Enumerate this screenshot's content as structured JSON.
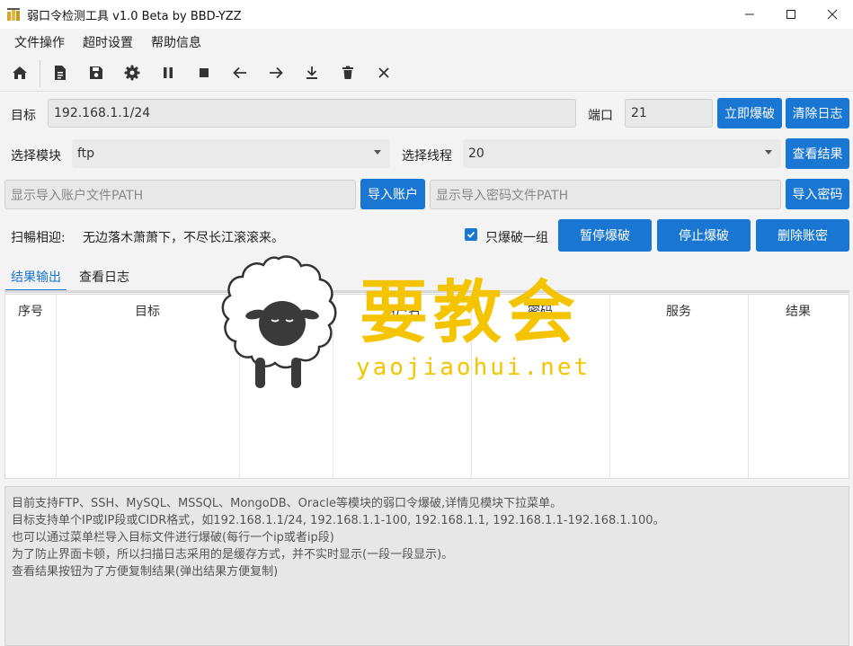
{
  "window": {
    "title": "弱口令检测工具 v1.0 Beta by BBD-YZZ",
    "minimize_icon": "minimize-icon",
    "maximize_icon": "maximize-icon",
    "close_icon": "close-icon"
  },
  "menu": [
    "文件操作",
    "超时设置",
    "帮助信息"
  ],
  "toolbar": [
    "home-icon",
    "document-icon",
    "save-icon",
    "gear-icon",
    "pause-icon",
    "stop-icon",
    "arrow-left-icon",
    "arrow-right-icon",
    "download-icon",
    "trash-icon",
    "close-icon"
  ],
  "target": {
    "label": "目标",
    "value": "192.168.1.1/24"
  },
  "port": {
    "label": "端口",
    "value": "21"
  },
  "buttons": {
    "start": "立即爆破",
    "clear_log": "清除日志",
    "view_results": "查看结果",
    "import_account": "导入账户",
    "import_password": "导入密码",
    "pause": "暂停爆破",
    "stop": "停止爆破",
    "delete_account": "删除账密"
  },
  "module": {
    "label": "选择模块",
    "value": "ftp"
  },
  "threads": {
    "label": "选择线程",
    "value": "20"
  },
  "account_path": {
    "placeholder": "显示导入账户文件PATH"
  },
  "password_path": {
    "placeholder": "显示导入密码文件PATH"
  },
  "scan": {
    "label": "扫暢相迎:",
    "text": "无边落木萧萧下，不尽长江滚滚来。"
  },
  "only_one_group": {
    "label": "只爆破一组",
    "checked": true
  },
  "tabs": {
    "results": "结果输出",
    "logs": "查看日志",
    "active": "results"
  },
  "table": {
    "columns": [
      "序号",
      "目标",
      "端口",
      "用户名",
      "密码",
      "服务",
      "结果"
    ],
    "rows": []
  },
  "log_lines": [
    "目前支持FTP、SSH、MySQL、MSSQL、MongoDB、Oracle等模块的弱口令爆破,详情见模块下拉菜单。",
    "目标支持单个IP或IP段或CIDR格式，如192.168.1.1/24, 192.168.1.1-100, 192.168.1.1, 192.168.1.1-192.168.1.100。",
    "也可以通过菜单栏导入目标文件进行爆破(每行一个ip或者ip段)",
    "为了防止界面卡顿，所以扫描日志采用的是缓存方式，并不实时显示(一段一段显示)。",
    "查看结果按钮为了方便复制结果(弹出结果方便复制)"
  ],
  "watermark": {
    "text": "要教会",
    "url": "yaojiaohui.net",
    "color": "#f5c400"
  },
  "colors": {
    "accent": "#1976d2"
  }
}
